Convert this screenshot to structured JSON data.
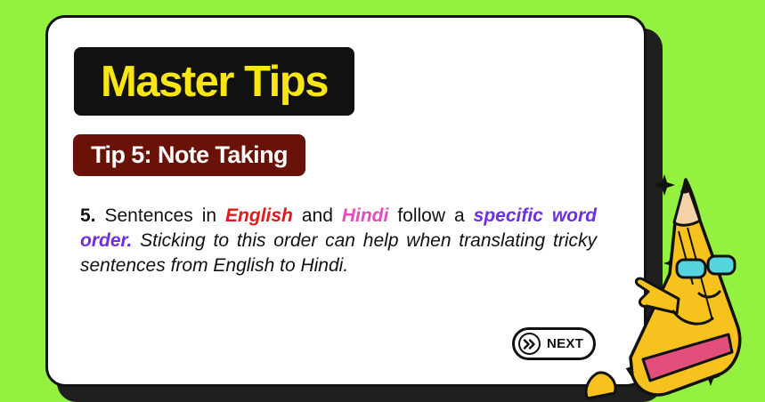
{
  "card": {
    "title": "Master Tips",
    "subtitle": "Tip 5: Note Taking"
  },
  "tip": {
    "number": "5.",
    "text_part1": " Sentences in ",
    "kw_english": "English",
    "text_part2": " and ",
    "kw_hindi": "Hindi",
    "text_part3": " follow a ",
    "kw_order": "specific word order.",
    "text_part4": " Sticking to this order can help when translating tricky sentences from English to Hindi."
  },
  "buttons": {
    "next_label": "NEXT"
  },
  "colors": {
    "background": "#95f13f",
    "title_text": "#f7e614",
    "subtitle_bg": "#6a1208",
    "keyword_english": "#e01a1a",
    "keyword_hindi": "#e14fb8",
    "keyword_order": "#6c2ee8"
  },
  "icons": {
    "next": "double-chevron-right-icon",
    "mascot": "pencil-character-with-sunglasses",
    "sparkles": "sparkle-icon"
  }
}
